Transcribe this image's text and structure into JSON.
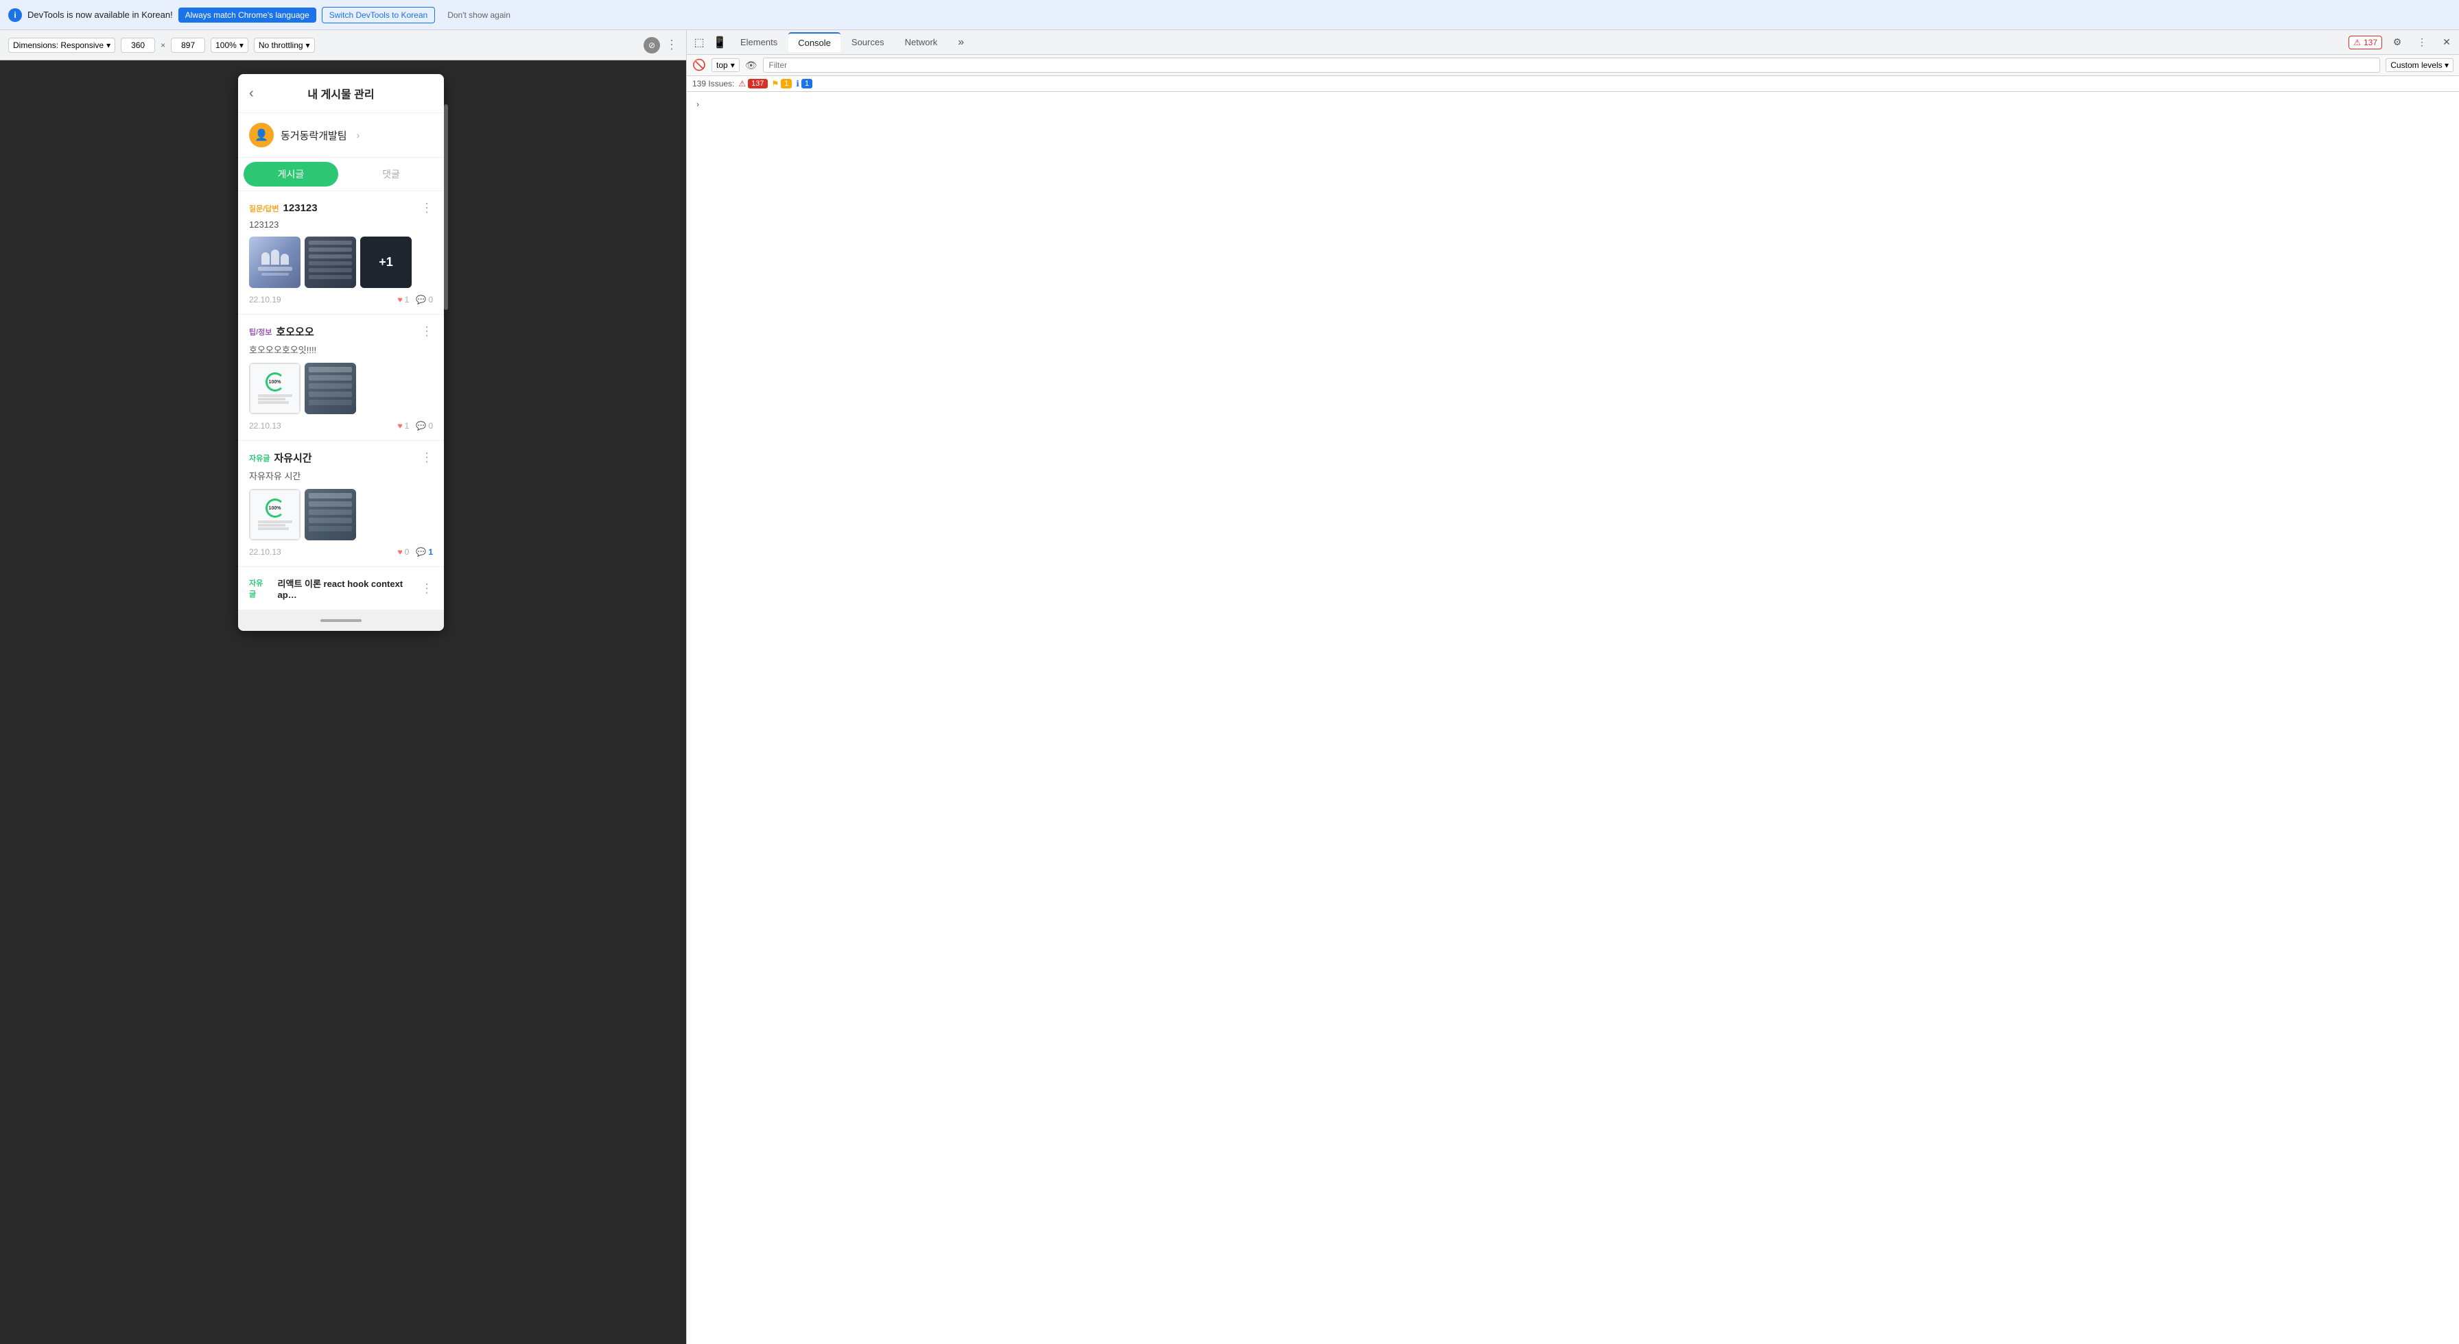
{
  "browser": {
    "responsive_label": "Dimensions: Responsive",
    "width": "360",
    "height": "897",
    "zoom": "100%",
    "throttle": "No throttling"
  },
  "devtools": {
    "banner_text": "DevTools is now available in Korean!",
    "btn_match": "Always match Chrome's language",
    "btn_korean": "Switch DevTools to Korean",
    "btn_dismiss": "Don't show again",
    "tabs": [
      "Elements",
      "Console",
      "Sources",
      "Network"
    ],
    "active_tab": "Console",
    "top_context": "top",
    "filter_placeholder": "Filter",
    "custom_levels": "Custom levels",
    "issues_label": "139 Issues:",
    "issues_red": "137",
    "issues_yellow": "1",
    "issues_blue": "1",
    "error_count": "137"
  },
  "app": {
    "title": "내 게시물 관리",
    "profile_name": "동거동락개발팀",
    "tab_post": "게시글",
    "tab_comment": "댓글",
    "posts": [
      {
        "category": "질문/답변",
        "category_class": "cat-qa",
        "title": "123123",
        "content": "123123",
        "date": "22.10.19",
        "likes": "1",
        "comments": "0",
        "has_images": true,
        "image_count": 3,
        "image_extra": "+1"
      },
      {
        "category": "팁/정보",
        "category_class": "cat-tip",
        "title": "호오오오",
        "content": "호오오오호오잇!!!!",
        "date": "22.10.13",
        "likes": "1",
        "comments": "0",
        "has_images": true,
        "image_count": 2
      },
      {
        "category": "자유글",
        "category_class": "cat-free",
        "title": "자유시간",
        "content": "자유자유 시간",
        "date": "22.10.13",
        "likes": "0",
        "comments": "1",
        "has_images": true,
        "image_count": 2
      },
      {
        "category": "자유글",
        "category_class": "cat-free",
        "title": "리액트 이론 react hook context ap…",
        "content": "",
        "date": "",
        "likes": "",
        "comments": "",
        "has_images": false
      }
    ]
  }
}
